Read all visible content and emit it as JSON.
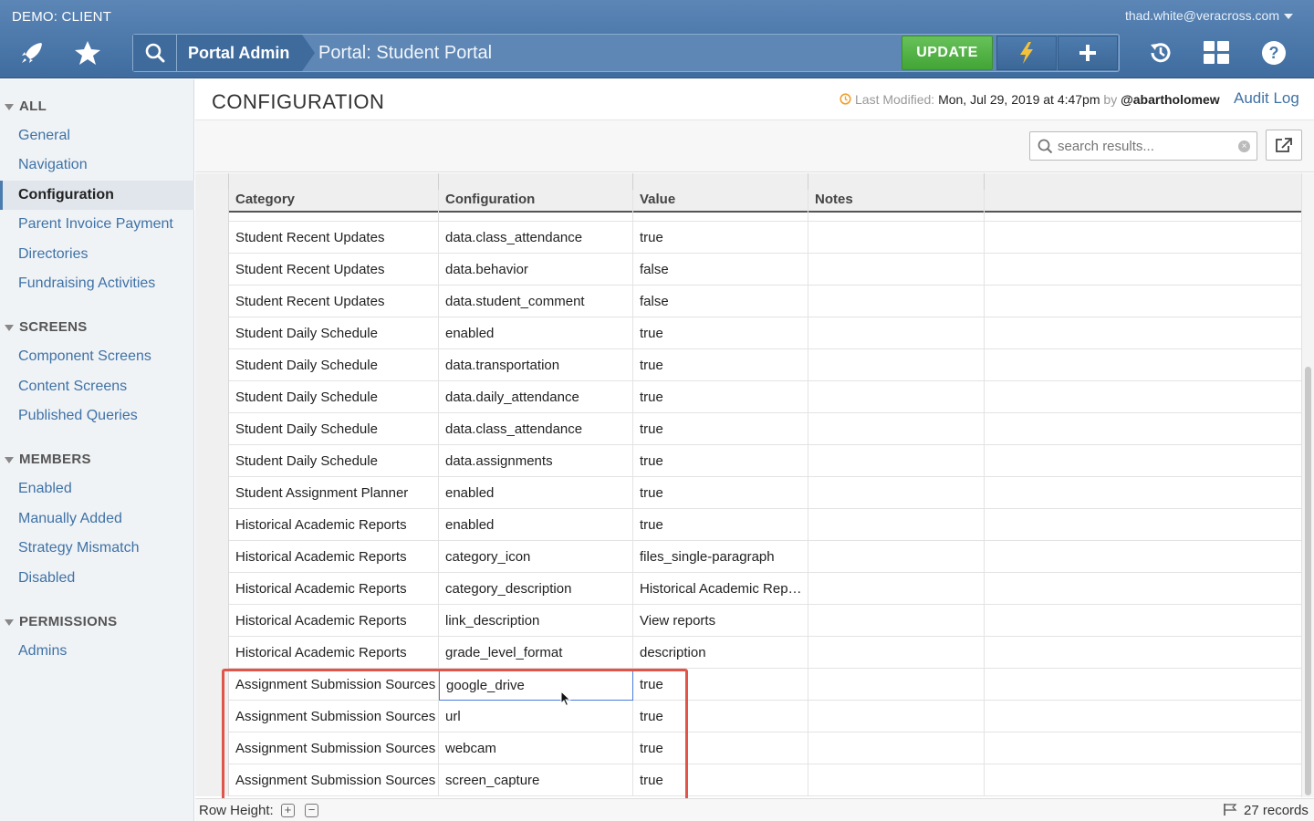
{
  "header": {
    "client": "DEMO: CLIENT",
    "user_email": "thad.white@veracross.com",
    "crumb_admin": "Portal Admin",
    "crumb_title": "Portal: Student Portal",
    "update_label": "UPDATE",
    "icons": [
      "rocket-icon",
      "star-icon",
      "search-icon",
      "lightning-icon",
      "plus-icon",
      "history-icon",
      "grid-icon",
      "help-icon"
    ],
    "colors": {
      "bar": "#4a78ab",
      "update": "#4fb13f"
    }
  },
  "sidebar": {
    "sections": [
      {
        "label": "ALL",
        "items": [
          "General",
          "Navigation",
          "Configuration",
          "Parent Invoice Payment",
          "Directories",
          "Fundraising Activities"
        ]
      },
      {
        "label": "SCREENS",
        "items": [
          "Component Screens",
          "Content Screens",
          "Published Queries"
        ]
      },
      {
        "label": "MEMBERS",
        "items": [
          "Enabled",
          "Manually Added",
          "Strategy Mismatch",
          "Disabled"
        ]
      },
      {
        "label": "PERMISSIONS",
        "items": [
          "Admins"
        ]
      }
    ],
    "active_item": "Configuration"
  },
  "main": {
    "title": "CONFIGURATION",
    "last_modified_label": "Last Modified:",
    "last_modified_value": "Mon, Jul 29, 2019 at 4:47pm",
    "by_label": "by",
    "modified_by": "@abartholomew",
    "audit_log": "Audit Log",
    "search_placeholder": "search results..."
  },
  "table": {
    "columns": [
      "Category",
      "Configuration",
      "Value",
      "Notes"
    ],
    "rows": [
      [
        "Student Recent Updates",
        "data.class_attendance",
        "true",
        ""
      ],
      [
        "Student Recent Updates",
        "data.behavior",
        "false",
        ""
      ],
      [
        "Student Recent Updates",
        "data.student_comment",
        "false",
        ""
      ],
      [
        "Student Daily Schedule",
        "enabled",
        "true",
        ""
      ],
      [
        "Student Daily Schedule",
        "data.transportation",
        "true",
        ""
      ],
      [
        "Student Daily Schedule",
        "data.daily_attendance",
        "true",
        ""
      ],
      [
        "Student Daily Schedule",
        "data.class_attendance",
        "true",
        ""
      ],
      [
        "Student Daily Schedule",
        "data.assignments",
        "true",
        ""
      ],
      [
        "Student Assignment Planner",
        "enabled",
        "true",
        ""
      ],
      [
        "Historical Academic Reports",
        "enabled",
        "true",
        ""
      ],
      [
        "Historical Academic Reports",
        "category_icon",
        "files_single-paragraph",
        ""
      ],
      [
        "Historical Academic Reports",
        "category_description",
        "Historical Academic Rep…",
        ""
      ],
      [
        "Historical Academic Reports",
        "link_description",
        "View reports",
        ""
      ],
      [
        "Historical Academic Reports",
        "grade_level_format",
        "description",
        ""
      ],
      [
        "Assignment Submission Sources",
        "google_drive",
        "true",
        ""
      ],
      [
        "Assignment Submission Sources",
        "url",
        "true",
        ""
      ],
      [
        "Assignment Submission Sources",
        "webcam",
        "true",
        ""
      ],
      [
        "Assignment Submission Sources",
        "screen_capture",
        "true",
        ""
      ]
    ],
    "selected_row": 14,
    "highlight_color": "#e0544a"
  },
  "footer": {
    "row_height_label": "Row Height:",
    "records": "27 records"
  }
}
